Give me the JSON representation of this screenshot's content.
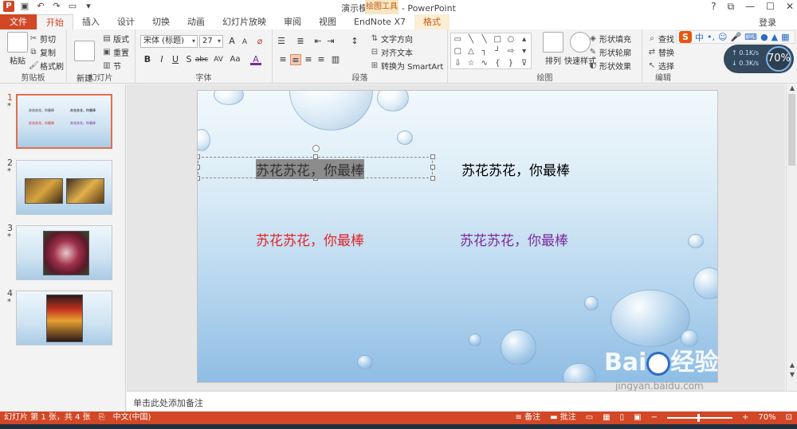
{
  "window": {
    "title": "演示模板.pptx - PowerPoint",
    "drawing_tools_label": "绘图工具",
    "controls": [
      "?",
      "⧉",
      "—",
      "☐",
      "✕"
    ],
    "login": "登录"
  },
  "tabs": [
    {
      "label": "文件"
    },
    {
      "label": "开始"
    },
    {
      "label": "插入"
    },
    {
      "label": "设计"
    },
    {
      "label": "切换"
    },
    {
      "label": "动画"
    },
    {
      "label": "幻灯片放映"
    },
    {
      "label": "审阅"
    },
    {
      "label": "视图"
    },
    {
      "label": "EndNote X7"
    },
    {
      "label": "格式"
    }
  ],
  "ribbon": {
    "clipboard": {
      "label": "剪贴板",
      "paste": "粘贴",
      "cut": "剪切",
      "copy": "复制",
      "format_painter": "格式刷"
    },
    "slides": {
      "label": "幻灯片",
      "new_slide": "新建\n幻灯片",
      "layout": "版式",
      "reset": "重置",
      "section": "节"
    },
    "font": {
      "label": "字体",
      "font_name": "宋体 (标题)",
      "font_size": "27",
      "bold": "B",
      "italic": "I",
      "underline": "U",
      "shadow": "S",
      "strike": "abc",
      "spacing": "AV",
      "case": "Aa",
      "color": "A",
      "grow": "A",
      "shrink": "A"
    },
    "paragraph": {
      "label": "段落",
      "text_direction": "文字方向",
      "align_text": "对齐文本",
      "smartart": "转换为 SmartArt"
    },
    "drawing": {
      "label": "绘图",
      "arrange": "排列",
      "quick_styles": "快速样式",
      "shape_fill": "形状填充",
      "shape_outline": "形状轮廓",
      "shape_effects": "形状效果"
    },
    "editing": {
      "label": "编辑",
      "find": "查找",
      "replace": "替换",
      "select": "选择"
    }
  },
  "ime": {
    "logo": "S",
    "mode": "中",
    "punct": "•,"
  },
  "net_widget": {
    "up": "0.1K/s",
    "down": "0.3K/s",
    "percent": "70%"
  },
  "thumbnails": [
    {
      "num": "1",
      "star": "*"
    },
    {
      "num": "2",
      "star": "*"
    },
    {
      "num": "3",
      "star": "*"
    },
    {
      "num": "4",
      "star": "*"
    }
  ],
  "slide": {
    "texts": {
      "top_left": "苏花苏花，你最棒",
      "top_right": "苏花苏花，你最棒",
      "bottom_left": "苏花苏花，你最棒",
      "bottom_right": "苏花苏花，你最棒"
    },
    "colors": {
      "top_left": "#333333",
      "top_right": "#000000",
      "bottom_left": "#e0242a",
      "bottom_right": "#7a2b9c"
    }
  },
  "watermark": {
    "brand": "Bai",
    "brand2": "经验",
    "url": "jingyan.baidu.com"
  },
  "notes": {
    "placeholder": "单击此处添加备注"
  },
  "status": {
    "slide_info": "幻灯片 第 1 张，共 4 张",
    "language": "中文(中国)",
    "notes": "备注",
    "comments": "批注",
    "zoom": "70%"
  }
}
